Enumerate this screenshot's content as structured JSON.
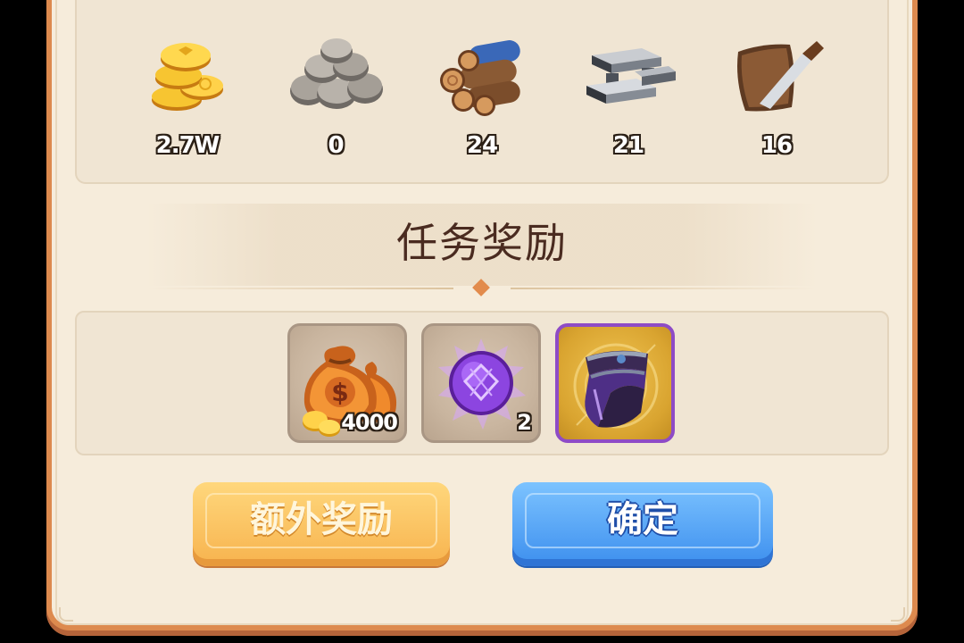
{
  "resources": [
    {
      "name": "gold-coins",
      "value": "2.7W"
    },
    {
      "name": "stone",
      "value": "0"
    },
    {
      "name": "wood",
      "value": "24"
    },
    {
      "name": "iron",
      "value": "21"
    },
    {
      "name": "leather",
      "value": "16"
    }
  ],
  "section": {
    "title": "任务奖励"
  },
  "rewards": [
    {
      "name": "money-bag",
      "count": "4000",
      "rarity": "common"
    },
    {
      "name": "purple-orb",
      "count": "2",
      "rarity": "common"
    },
    {
      "name": "purple-bracer",
      "count": "",
      "rarity": "epic"
    }
  ],
  "buttons": {
    "extra_label": "额外奖励",
    "confirm_label": "确定"
  },
  "colors": {
    "panel_border": "#dd8a4e",
    "panel_bg": "#f6ecdb",
    "title_text": "#4a2b20",
    "extra_button": "#f7b34e",
    "confirm_button": "#3d8fee",
    "epic_frame": "#8e4bc6"
  }
}
